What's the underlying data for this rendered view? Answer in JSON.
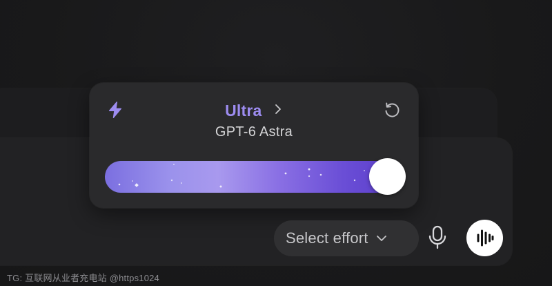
{
  "effort_popup": {
    "level_title": "Ultra",
    "model_name": "GPT-6 Astra",
    "slider_level": 1.0,
    "accent_color": "#9d8cf0",
    "icons": {
      "left": "lightning-bolt-icon",
      "title_suffix": "chevron-right-icon",
      "right": "reset-icon"
    }
  },
  "composer": {
    "select_effort_label": "Select effort",
    "select_effort_icon": "chevron-down-icon",
    "mic_icon": "microphone-icon",
    "voice_icon": "voice-waveform-icon"
  },
  "watermark": "TG: 互联网从业者充电站 @https1024"
}
